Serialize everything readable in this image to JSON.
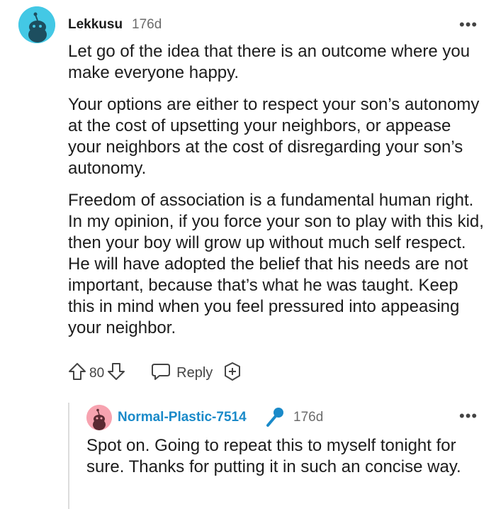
{
  "comment": {
    "username": "Lekkusu",
    "age": "176d",
    "more_icon": "more-dots-icon",
    "paragraphs": [
      "Let go of the idea that there is an outcome where you make everyone happy.",
      "Your options are either to respect your son’s autonomy at the cost of upsetting your neighbors, or appease your neighbors at the cost of disregarding your son’s autonomy.",
      "Freedom of association is a fundamental human right. In my opinion, if you force your son to play with this kid, then your boy will grow up without much self respect. He will have adopted the belief that his needs are not important, because that’s what he was taught. Keep this in mind when you feel pressured into appeasing your neighbor."
    ],
    "score": "80",
    "reply_label": "Reply",
    "avatar_color": "#43c8e5"
  },
  "reply": {
    "username": "Normal-Plastic-7514",
    "badge_icon": "microphone-icon",
    "age": "176d",
    "text": "Spot on. Going to repeat this to myself tonight for sure. Thanks for putting it in such an concise way.",
    "avatar_color": "#f7a3b0",
    "username_color": "#1a8ac9"
  }
}
